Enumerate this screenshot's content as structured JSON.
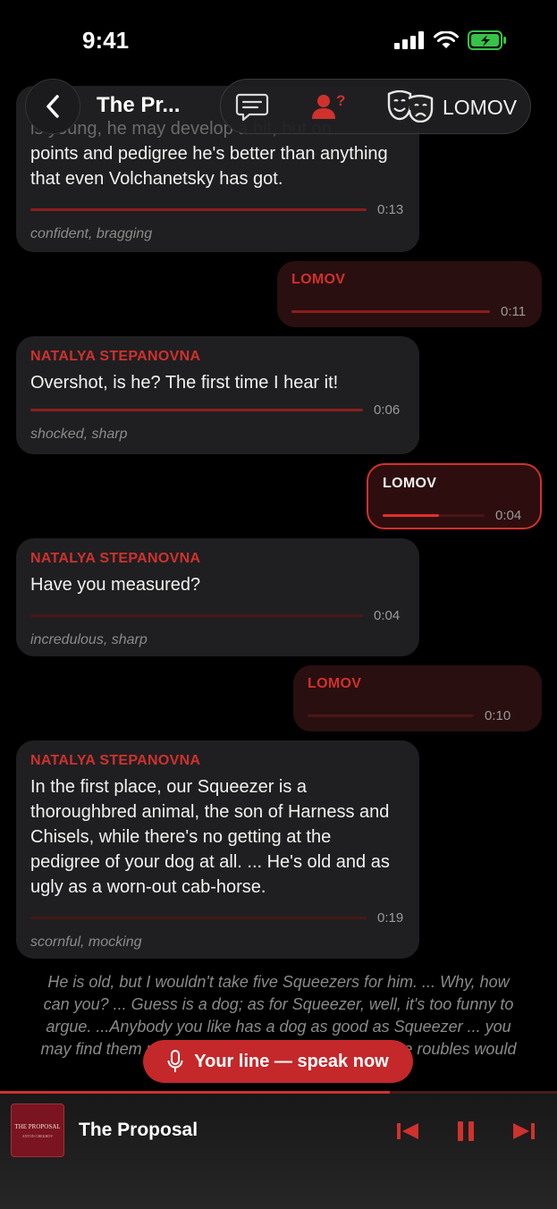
{
  "status": {
    "time": "9:41"
  },
  "nav": {
    "title": "The Pr...",
    "role_label": "LOMOV"
  },
  "messages": [
    {
      "speaker": "",
      "text_partial_top": "is young, he may develop a bit, but on",
      "text": "points and pedigree he's better than anything that even Volchanetsky has got.",
      "duration": "0:13",
      "tone": "confident, bragging"
    },
    {
      "speaker": "LOMOV",
      "duration": "0:11"
    },
    {
      "speaker": "NATALYA STEPANOVNA",
      "text": "Overshot, is he? The first time I hear it!",
      "duration": "0:06",
      "tone": "shocked, sharp"
    },
    {
      "speaker": "LOMOV",
      "duration": "0:04",
      "progress": 0.55
    },
    {
      "speaker": "NATALYA STEPANOVNA",
      "text": "Have you measured?",
      "duration": "0:04",
      "tone": "incredulous, sharp"
    },
    {
      "speaker": "LOMOV",
      "duration": "0:10"
    },
    {
      "speaker": "NATALYA STEPANOVNA",
      "text": "In the first place, our Squeezer is a thoroughbred animal, the son of Harness and Chisels, while there's no getting at the pedigree of your dog at all. ... He's old and as ugly as a worn-out cab-horse.",
      "duration": "0:19",
      "tone": "scornful, mocking"
    }
  ],
  "narration": "He is old, but I wouldn't take five Squeezers for him. ... Why, how can you? ... Guess is a dog; as for Squeezer, well, it's too funny to argue. ...Anybody you like has a dog as good as Squeezer ... you may find them under every bush almost. Twenty-five roubles would be a handsome price to pay for him.",
  "speak_button": {
    "label": "Your line — speak now"
  },
  "player": {
    "title": "The Proposal",
    "cover_title": "THE PROPOSAL",
    "cover_author": "ANTON CHEKHOV",
    "progress": 0.7
  },
  "colors": {
    "accent": "#d0312d",
    "bubble": "#1f1f21",
    "user_bubble": "#2a0f10"
  }
}
